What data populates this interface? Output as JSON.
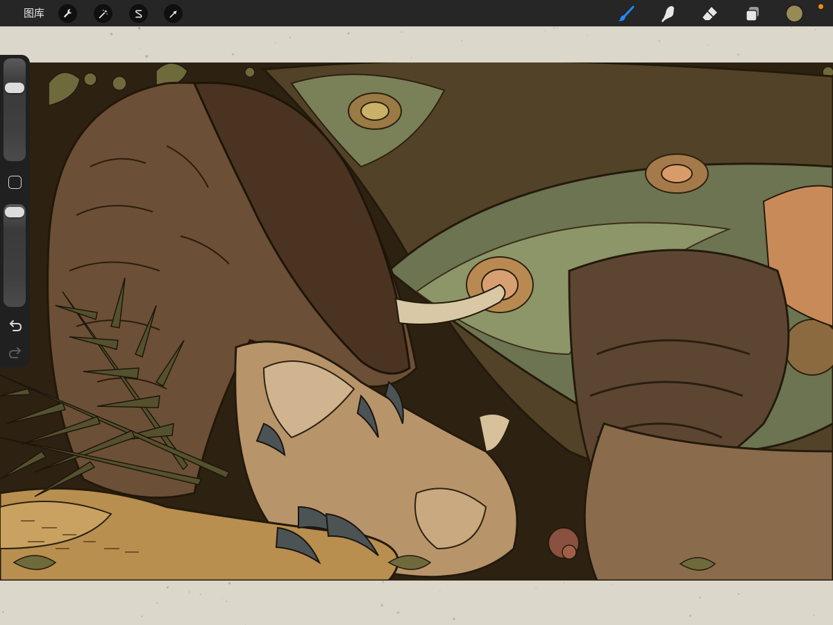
{
  "toolbar": {
    "gallery_label": "图库",
    "left_tools": [
      {
        "name": "actions",
        "icon": "wrench-icon"
      },
      {
        "name": "adjustments",
        "icon": "magic-wand-icon"
      },
      {
        "name": "selection",
        "icon": "selection-s-icon"
      },
      {
        "name": "transform",
        "icon": "arrow-cursor-icon"
      }
    ],
    "right_tools": [
      {
        "name": "brush",
        "icon": "brush-icon",
        "active": true
      },
      {
        "name": "smudge",
        "icon": "smudge-finger-icon",
        "active": false
      },
      {
        "name": "eraser",
        "icon": "eraser-icon",
        "active": false
      },
      {
        "name": "layers",
        "icon": "layers-icon",
        "active": false
      }
    ],
    "current_color": "#968a55",
    "active_color": "#1e8bff",
    "notification_color": "#f28a1c"
  },
  "sidebar": {
    "brush_size": 0.75,
    "opacity": 1.0,
    "modify_icon": "square-icon",
    "undo_icon": "undo-icon",
    "redo_icon": "redo-icon",
    "redo_enabled": false
  },
  "canvas": {
    "paper_color": "#dcd7cb",
    "artwork": "illustration-art-nouveau-creatures"
  }
}
